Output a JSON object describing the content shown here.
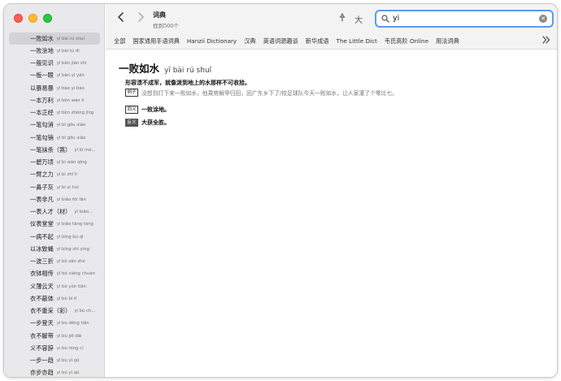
{
  "window": {
    "title": "词典",
    "result_count": "找到500个"
  },
  "search": {
    "value": "yi",
    "placeholder": ""
  },
  "toolbar": {
    "back_icon": "chevron-left-icon",
    "forward_icon": "chevron-right-icon",
    "pin_icon": "pin-icon",
    "font_label": "大"
  },
  "tabs": [
    "全部",
    "国家通用手语词典",
    "Hanzii Dictionary",
    "汉典",
    "英语词源趣谈",
    "新华成语",
    "The Little Dict",
    "韦氏高阶 Online",
    "用法词典"
  ],
  "sidebar": {
    "items": [
      {
        "word": "一败如水",
        "pinyin": "yī bài rú shuǐ"
      },
      {
        "word": "一败涂地",
        "pinyin": "yī bài tú dì"
      },
      {
        "word": "一般见识",
        "pinyin": "yī bān jiàn shí"
      },
      {
        "word": "一板一眼",
        "pinyin": "yī bǎn yī yǎn"
      },
      {
        "word": "以暴易暴",
        "pinyin": "yǐ bào yì bào"
      },
      {
        "word": "一本万利",
        "pinyin": "yī běn wàn lì"
      },
      {
        "word": "一本正经",
        "pinyin": "yī běn zhèng jīng"
      },
      {
        "word": "一笔勾消",
        "pinyin": "yī bǐ gōu xiāo"
      },
      {
        "word": "一笔勾销",
        "pinyin": "yī bǐ gōu xiāo"
      },
      {
        "word": "一笔抹杀（煞）",
        "pinyin": "yī bǐ mǒ..."
      },
      {
        "word": "一碧万顷",
        "pinyin": "yī bì wàn qǐng"
      },
      {
        "word": "一臂之力",
        "pinyin": "yī bì zhī lì"
      },
      {
        "word": "一鼻子灰",
        "pinyin": "yī bí zi huī"
      },
      {
        "word": "一表非凡",
        "pinyin": "yī biǎo fēi fán"
      },
      {
        "word": "一表人才（材）",
        "pinyin": "yī biǎo..."
      },
      {
        "word": "仪表堂堂",
        "pinyin": "yí biǎo táng táng"
      },
      {
        "word": "一病不起",
        "pinyin": "yī bìng bù qǐ"
      },
      {
        "word": "以冰致蝇",
        "pinyin": "yǐ bīng zhì yíng"
      },
      {
        "word": "一波三折",
        "pinyin": "yī bō sān zhé"
      },
      {
        "word": "衣钵相传",
        "pinyin": "yī bō xiāng chuán"
      },
      {
        "word": "义薄云天",
        "pinyin": "yì bó yún tiān"
      },
      {
        "word": "衣不蔽体",
        "pinyin": "yī bù bì tǐ"
      },
      {
        "word": "衣不重采（彩）",
        "pinyin": "yī bù ch..."
      },
      {
        "word": "一步登天",
        "pinyin": "yī bù dēng tiān"
      },
      {
        "word": "衣不解带",
        "pinyin": "yī bù jiě dài"
      },
      {
        "word": "义不容辞",
        "pinyin": "yì bù róng cí"
      },
      {
        "word": "一步一趋",
        "pinyin": "yī bù yī qū"
      },
      {
        "word": "亦步亦趋",
        "pinyin": "yì bù yì qū"
      }
    ],
    "selected_index": 0
  },
  "entry": {
    "headword": "一败如水",
    "pinyin": "yī bài rú shuǐ",
    "definition": "形容溃不成军，就像泼到地上的水那样不可收拾。",
    "example_tag": "例子",
    "example": "没想到打下来一败如水，他乘势解甲归田，回广东乡下了/校足球队今天一败如水，让人家灌了个零比七。",
    "synonym_tag": "同义",
    "synonym": "一败涂地。",
    "antonym_tag": "反义",
    "antonym": "大获全胜。"
  },
  "colors": {
    "search_focus": "#5a9bf3",
    "sidebar_bg": "#e9e8ea",
    "selected_bg": "#d3d2d5"
  }
}
